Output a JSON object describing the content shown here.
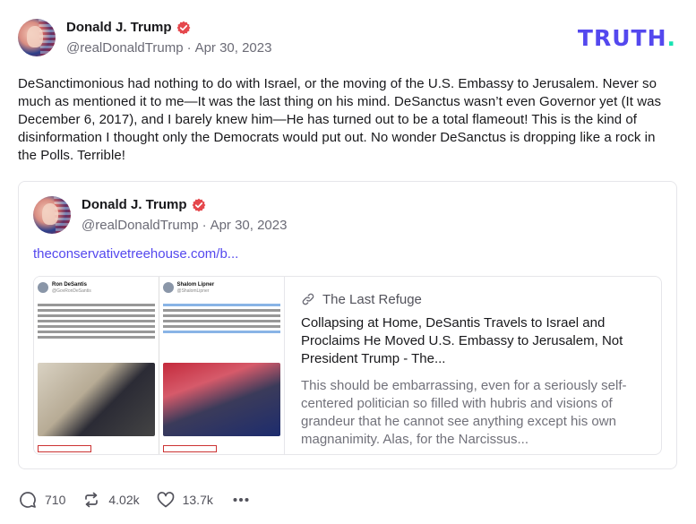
{
  "post": {
    "display_name": "Donald J. Trump",
    "handle": "@realDonaldTrump",
    "separator": "·",
    "date": "Apr 30, 2023",
    "body": "DeSanctimonious had nothing to do with Israel, or the moving of the U.S. Embassy to Jerusalem. Never so much as mentioned it to me—It was the last thing on his mind. DeSanctus wasn’t even Governor yet (It was December 6, 2017), and I barely knew him—He has turned out to be a total flameout! This is the kind of disinformation I thought only the Democrats would put out. No wonder DeSanctus is dropping like a rock in the Polls. Terrible!"
  },
  "brand": {
    "logo_text": "TRUTH",
    "logo_dot": ".",
    "logo_color": "#5448ee",
    "logo_dot_color": "#17e3b2"
  },
  "quote": {
    "display_name": "Donald J. Trump",
    "handle": "@realDonaldTrump",
    "separator": "·",
    "date": "Apr 30, 2023",
    "link_text": "theconservativetreehouse.com/b...",
    "card": {
      "source": "The Last Refuge",
      "title": "Collapsing at Home, DeSantis Travels to Israel and Proclaims He Moved U.S. Embassy to Jerusalem, Not President Trump - The...",
      "description": "This should be embarrassing, even for a seriously self-centered politician so filled with hubris and visions of grandeur that he cannot see anything except his own magnanimity.  Alas, for the Narcissus...",
      "thumb_left_name": "Ron DeSantis",
      "thumb_left_handle": "@GovRonDeSantis",
      "thumb_right_name": "Shalom Lipner",
      "thumb_right_handle": "@ShalomLipner"
    }
  },
  "actions": {
    "replies": "710",
    "retruths": "4.02k",
    "likes": "13.7k"
  },
  "icons": [
    "verified-icon",
    "link-icon",
    "reply-icon",
    "retruth-icon",
    "like-icon",
    "more-icon"
  ],
  "colors": {
    "accent": "#5448ee",
    "verified": "#e5484d"
  }
}
